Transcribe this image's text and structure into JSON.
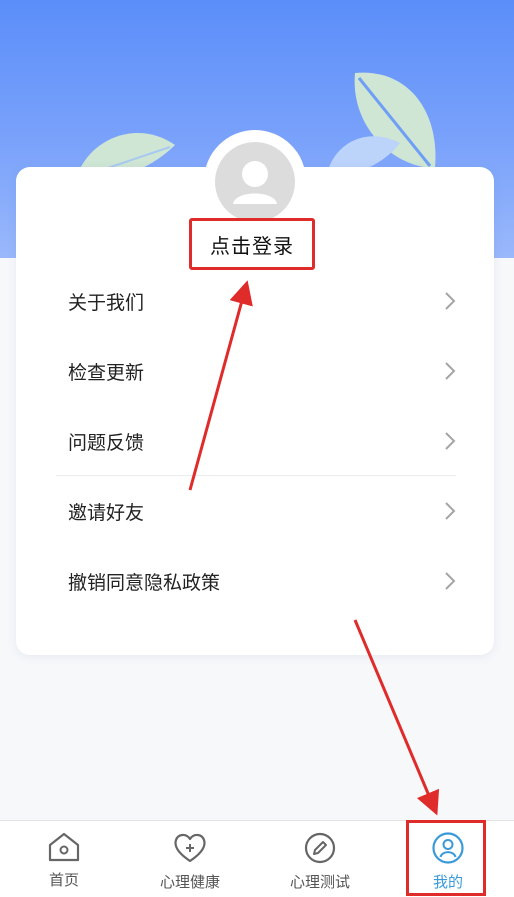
{
  "profile": {
    "login_label": "点击登录"
  },
  "menu": {
    "items": [
      {
        "label": "关于我们"
      },
      {
        "label": "检查更新"
      },
      {
        "label": "问题反馈"
      },
      {
        "label": "邀请好友"
      },
      {
        "label": "撤销同意隐私政策"
      }
    ]
  },
  "tabbar": {
    "tabs": [
      {
        "label": "首页",
        "icon": "home-icon"
      },
      {
        "label": "心理健康",
        "icon": "heart-plus-icon"
      },
      {
        "label": "心理测试",
        "icon": "pencil-icon"
      },
      {
        "label": "我的",
        "icon": "user-icon",
        "active": true
      }
    ]
  },
  "colors": {
    "header_blue": "#5b8ef9",
    "active_tab": "#3a9ad9",
    "annotation_red": "#e02b2b"
  }
}
